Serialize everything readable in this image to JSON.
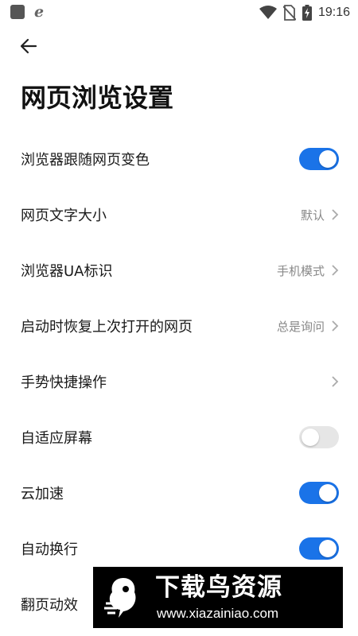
{
  "status_bar": {
    "browser_glyph": "e",
    "time": "19:16"
  },
  "header": {
    "title": "网页浏览设置"
  },
  "settings": {
    "items": [
      {
        "label": "浏览器跟随网页变色",
        "toggle": "on"
      },
      {
        "label": "网页文字大小",
        "value": "默认"
      },
      {
        "label": "浏览器UA标识",
        "value": "手机模式"
      },
      {
        "label": "启动时恢复上次打开的网页",
        "value": "总是询问"
      },
      {
        "label": "手势快捷操作"
      },
      {
        "label": "自适应屏幕",
        "toggle": "off"
      },
      {
        "label": "云加速",
        "toggle": "on"
      },
      {
        "label": "自动换行",
        "toggle": "on"
      },
      {
        "label": "翻页动效"
      }
    ]
  },
  "watermark": {
    "title": "下载鸟资源",
    "url": "www.xiazainiao.com"
  },
  "colors": {
    "accent": "#1a73e8",
    "toggle_off": "#e6e6e6",
    "secondary_text": "#888888"
  }
}
